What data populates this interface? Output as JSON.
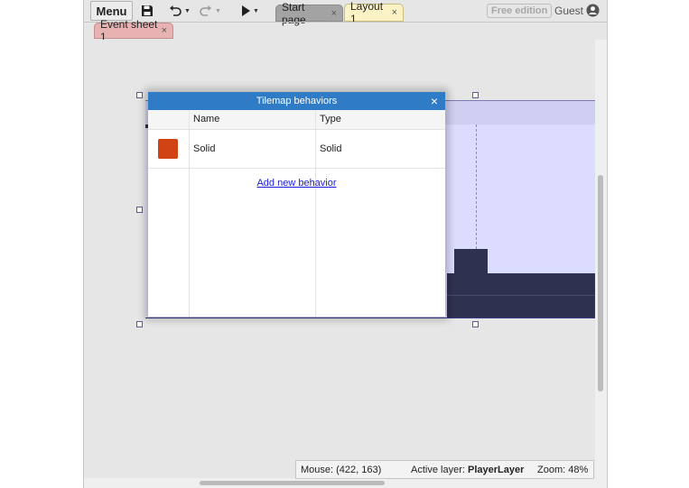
{
  "toolbar": {
    "menu_label": "Menu",
    "icons": [
      "save-icon",
      "undo-icon",
      "redo-icon",
      "play-icon"
    ]
  },
  "tabs": [
    {
      "label": "Start page",
      "close": "×"
    },
    {
      "label": "Layout 1",
      "close": "×",
      "active": true
    },
    {
      "label": "Event sheet 1",
      "close": "×"
    }
  ],
  "account": {
    "edition_badge": "Free edition",
    "user_label": "Guest"
  },
  "dialog": {
    "title": "Tilemap behaviors",
    "close": "×",
    "columns": {
      "name": "Name",
      "type": "Type"
    },
    "rows": [
      {
        "name": "Solid",
        "type": "Solid",
        "icon_color": "#d14312"
      }
    ],
    "add_link": "Add new behavior"
  },
  "status": {
    "mouse": "Mouse: (422, 163)",
    "active_layer_label": "Active layer:",
    "active_layer_value": "PlayerLayer",
    "zoom": "Zoom: 48%"
  },
  "colors": {
    "dialog_title_bar": "#2f7bc6",
    "layout_tab": "#fbf3c6",
    "event_sheet_tab": "#e8b2b2",
    "tilemap": "#2e3150",
    "layout_background": "#dcdcff"
  }
}
